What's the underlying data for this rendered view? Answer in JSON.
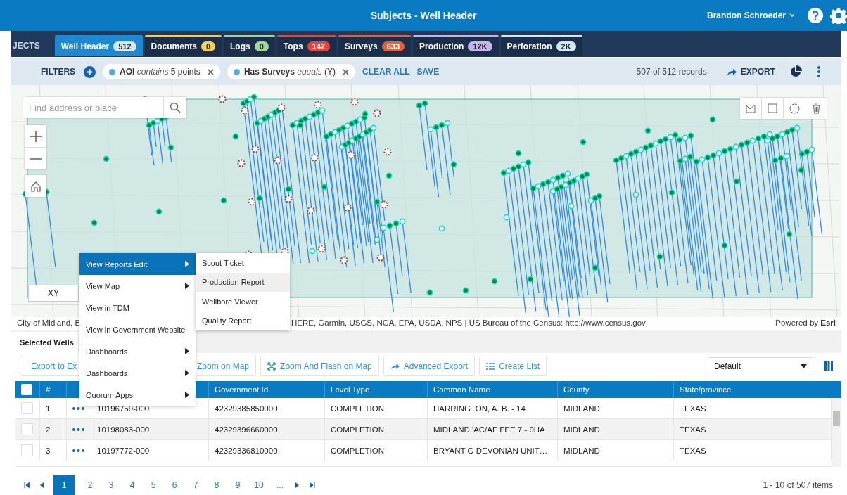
{
  "window": {
    "title": "Subjects - Well Header"
  },
  "user": {
    "name": "Brandon Schroeder"
  },
  "clipped_tab": "JECTS",
  "tabs": [
    {
      "label": "Well Header",
      "count": "512",
      "color": "#d6ebf8",
      "selected": true
    },
    {
      "label": "Documents",
      "count": "0",
      "color": "#f5d04e",
      "selected": false
    },
    {
      "label": "Logs",
      "count": "0",
      "color": "#9fd89a",
      "selected": false
    },
    {
      "label": "Tops",
      "count": "142",
      "color": "#e5453a",
      "selected": false
    },
    {
      "label": "Surveys",
      "count": "633",
      "color": "#e5603a",
      "selected": false
    },
    {
      "label": "Production",
      "count": "12K",
      "color": "#c6b4ec",
      "selected": false
    },
    {
      "label": "Perforation",
      "count": "2K",
      "color": "#cfe9fa",
      "selected": false
    }
  ],
  "filters": {
    "label": "FILTERS",
    "chips": [
      {
        "field": "AOI",
        "operator": "contains",
        "value": "5 points"
      },
      {
        "field": "Has Surveys",
        "operator": "equals",
        "value": "(Y)"
      }
    ],
    "clear_all": "CLEAR ALL",
    "save": "SAVE",
    "record_count": "507 of 512 records",
    "export": "EXPORT"
  },
  "map": {
    "search_placeholder": "Find address or place",
    "xy_button": "XY",
    "attribution_left": "City of Midland, B",
    "attribution_right": "HERE, Garmin, USGS, NGA, EPA, USDA, NPS | US Bureau of the Census: http://www.census.gov",
    "powered_by": "Powered by **Esri**"
  },
  "context_menu": {
    "items": [
      {
        "label": "View Reports Edit",
        "submenu": true,
        "selected": true
      },
      {
        "label": "View Map",
        "submenu": true,
        "selected": false
      },
      {
        "label": "View in TDM",
        "submenu": false,
        "selected": false
      },
      {
        "label": "View in Government Website",
        "submenu": false,
        "selected": false
      },
      {
        "label": "Dashboards",
        "submenu": true,
        "selected": false
      },
      {
        "label": "Dashboards",
        "submenu": true,
        "selected": false
      },
      {
        "label": "Quorum Apps",
        "submenu": true,
        "selected": false
      }
    ],
    "submenu_items": [
      {
        "label": "Scout Ticket",
        "selected": false
      },
      {
        "label": "Production Report",
        "selected": true
      },
      {
        "label": "Wellbore Viewer",
        "selected": false
      },
      {
        "label": "Quality Report",
        "selected": false
      }
    ]
  },
  "panel": {
    "tab": "Selected Wells",
    "toolbar": [
      {
        "label": "Export to Ex",
        "kind": "excel"
      },
      {
        "label": "Zoom on Map",
        "kind": "covered"
      },
      {
        "label": "Zoom And Flash on Map",
        "kind": "flash"
      },
      {
        "label": "Advanced Export",
        "kind": "share"
      },
      {
        "label": "Create List",
        "kind": "list"
      }
    ],
    "view_select": "Default"
  },
  "table": {
    "all_checked": false,
    "columns": [
      "#",
      "",
      "Government Id",
      "Level Type",
      "Common Name",
      "County",
      "State/province"
    ],
    "rows": [
      {
        "checked": false,
        "number": "1",
        "column_3": "10196759-000",
        "government_id": "42329385850000",
        "level_type": "COMPLETION",
        "common_name": "HARRINGTON, A. B. - 14",
        "county": "MIDLAND",
        "state": "TEXAS"
      },
      {
        "checked": false,
        "number": "2",
        "column_3": "10198083-000",
        "government_id": "42329396660000",
        "level_type": "COMPLETION",
        "common_name": "MIDLAND 'AC/AF FEE 7 - 9HA",
        "county": "MIDLAND",
        "state": "TEXAS"
      },
      {
        "checked": false,
        "number": "3",
        "column_3": "10197772-000",
        "government_id": "42329336810000",
        "level_type": "COMPLETION",
        "common_name": "BRYANT G DEVONIAN UNIT…",
        "county": "MIDLAND",
        "state": "TEXAS"
      }
    ]
  },
  "pager": {
    "pages": [
      {
        "label": "1",
        "selected": true
      },
      {
        "label": "2",
        "selected": false
      },
      {
        "label": "3",
        "selected": false
      },
      {
        "label": "4",
        "selected": false
      },
      {
        "label": "5",
        "selected": false
      },
      {
        "label": "6",
        "selected": false
      },
      {
        "label": "7",
        "selected": false
      },
      {
        "label": "8",
        "selected": false
      },
      {
        "label": "9",
        "selected": false
      },
      {
        "label": "10",
        "selected": false
      },
      {
        "label": "...",
        "selected": false
      }
    ],
    "summary": "1 - 10 of 507 items"
  }
}
